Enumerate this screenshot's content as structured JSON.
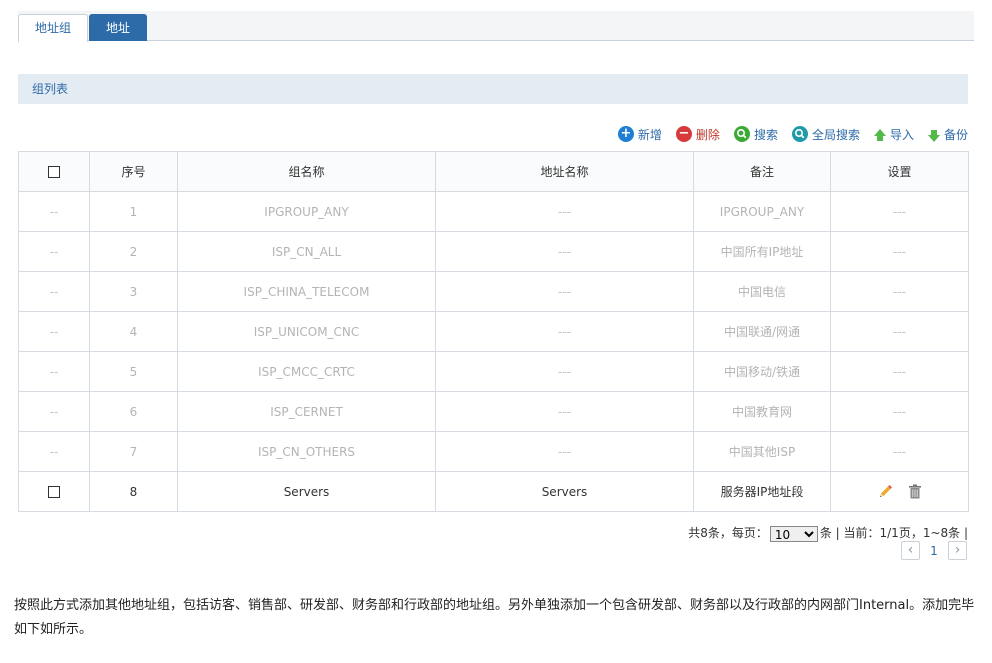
{
  "tabs": [
    {
      "label": "地址组",
      "active": true
    },
    {
      "label": "地址",
      "active": false
    }
  ],
  "section_title": "组列表",
  "toolbar": {
    "add_label": "新增",
    "delete_label": "删除",
    "search_label": "搜索",
    "global_search_label": "全局搜索",
    "import_label": "导入",
    "backup_label": "备份"
  },
  "table": {
    "headers": [
      "",
      "序号",
      "组名称",
      "地址名称",
      "备注",
      "设置"
    ],
    "rows": [
      {
        "select": "--",
        "index": "1",
        "group": "IPGROUP_ANY",
        "address": "---",
        "note": "IPGROUP_ANY",
        "settings": "---"
      },
      {
        "select": "--",
        "index": "2",
        "group": "ISP_CN_ALL",
        "address": "---",
        "note": "中国所有IP地址",
        "settings": "---"
      },
      {
        "select": "--",
        "index": "3",
        "group": "ISP_CHINA_TELECOM",
        "address": "---",
        "note": "中国电信",
        "settings": "---"
      },
      {
        "select": "--",
        "index": "4",
        "group": "ISP_UNICOM_CNC",
        "address": "---",
        "note": "中国联通/网通",
        "settings": "---"
      },
      {
        "select": "--",
        "index": "5",
        "group": "ISP_CMCC_CRTC",
        "address": "---",
        "note": "中国移动/铁通",
        "settings": "---"
      },
      {
        "select": "--",
        "index": "6",
        "group": "ISP_CERNET",
        "address": "---",
        "note": "中国教育网",
        "settings": "---"
      },
      {
        "select": "--",
        "index": "7",
        "group": "ISP_CN_OTHERS",
        "address": "---",
        "note": "中国其他ISP",
        "settings": "---"
      },
      {
        "index": "8",
        "group": "Servers",
        "address": "Servers",
        "note": "服务器IP地址段"
      }
    ]
  },
  "pagination": {
    "total_prefix": "共8条，每页：",
    "per_page": "10",
    "per_page_suffix": "条 | 当前：1/1页，1~8条 |",
    "current_page": "1",
    "prev_symbol": "‹",
    "next_symbol": "›"
  },
  "description": "按照此方式添加其他地址组，包括访客、销售部、研发部、财务部和行政部的地址组。另外单独添加一个包含研发部、财务部以及行政部的内网部门Internal。添加完毕如下如所示。",
  "colors": {
    "accent": "#2d6aa8",
    "add": "#1e7fd3",
    "delete": "#d73a3a",
    "search": "#3aaa35",
    "global_search": "#1f9aa6",
    "arrow": "#54b948"
  }
}
